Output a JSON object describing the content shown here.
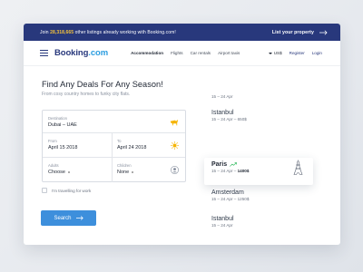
{
  "promo": {
    "prefix": "Join",
    "count": "28,318,665",
    "suffix": "other listings already working with Booking.com!",
    "cta": "List your property"
  },
  "header": {
    "logo_main": "Booking",
    "logo_dot": ".com",
    "nav": [
      "Accommodation",
      "Flights",
      "Car rentals",
      "Airport taxis"
    ],
    "currency": "US$",
    "register": "Register",
    "login": "Login"
  },
  "hero": {
    "title": "Find Any Deals For Any Season!",
    "subtitle": "From cosy country homes to funky city flats."
  },
  "form": {
    "destination_label": "Destination",
    "destination_value": "Dubai – UAE",
    "from_label": "From",
    "from_value": "April 15 2018",
    "to_label": "To",
    "to_value": "April 24 2018",
    "adults_label": "Adults",
    "adults_value": "Choose",
    "children_label": "Children",
    "children_value": "None",
    "work_checkbox": "I'm travelling for work",
    "search_button": "Search"
  },
  "destinations": [
    {
      "name": "",
      "dates": "15 – 24 Apr",
      "price": ""
    },
    {
      "name": "Istanbul",
      "dates": "15 – 24 Apr –",
      "price": "650$"
    },
    {
      "name": "Paris",
      "dates": "15 – 24 Apr –",
      "price": "1400$"
    },
    {
      "name": "Amsterdam",
      "dates": "15 – 24 Apr –",
      "price": "1250$"
    },
    {
      "name": "Istanbul",
      "dates": "15 – 24 Apr",
      "price": ""
    }
  ],
  "colors": {
    "brand_navy": "#28387c",
    "accent_yellow": "#f5c33b",
    "button_blue": "#3d8fdc",
    "trend_green": "#3fbf6a"
  }
}
